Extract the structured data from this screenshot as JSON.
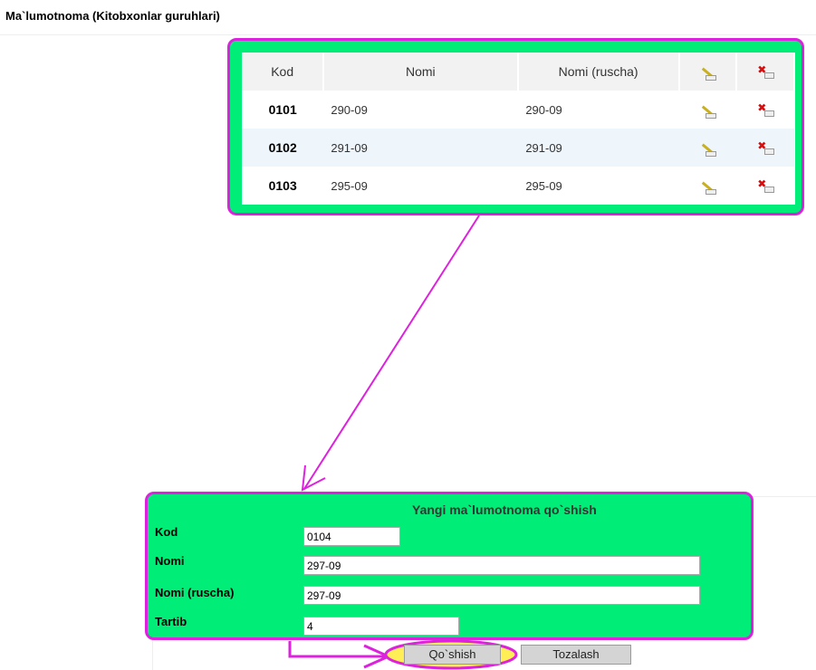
{
  "page": {
    "title": "Ma`lumotnoma (Kitobxonlar guruhlari)"
  },
  "table": {
    "headers": {
      "kod": "Kod",
      "nomi": "Nomi",
      "nomi_ruscha": "Nomi (ruscha)"
    },
    "header_icons": [
      "edit-icon",
      "delete-icon"
    ],
    "rows": [
      {
        "kod": "0101",
        "nomi": "290-09",
        "nomi_ruscha": "290-09"
      },
      {
        "kod": "0102",
        "nomi": "291-09",
        "nomi_ruscha": "291-09"
      },
      {
        "kod": "0103",
        "nomi": "295-09",
        "nomi_ruscha": "295-09"
      }
    ]
  },
  "form": {
    "heading": "Yangi ma`lumotnoma qo`shish",
    "fields": [
      {
        "label": "Kod",
        "value": "0104"
      },
      {
        "label": "Nomi",
        "value": "297-09"
      },
      {
        "label": "Nomi (ruscha)",
        "value": "297-09"
      },
      {
        "label": "Tartib",
        "value": "4"
      }
    ],
    "add_button": "Qo`shish",
    "clear_button": "Tozalash"
  },
  "colors": {
    "panel": "#00ee77",
    "highlight": "#dd22dd",
    "button_ring": "#ffee55"
  }
}
